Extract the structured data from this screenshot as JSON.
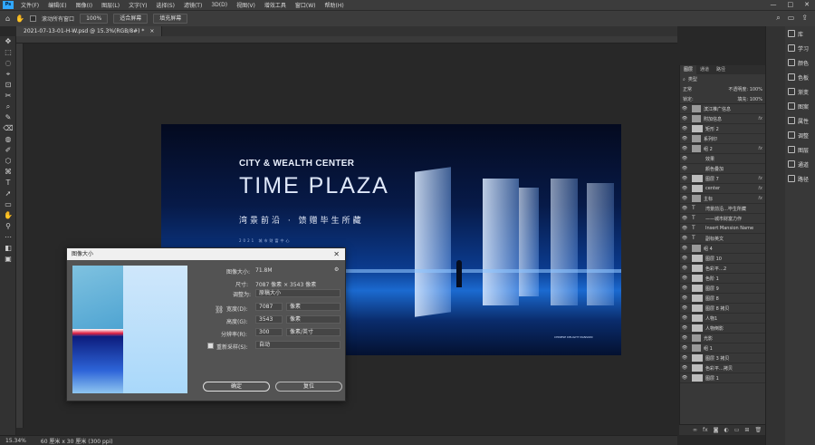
{
  "menubar": {
    "logo": "Ps",
    "items": [
      "文件(F)",
      "编辑(E)",
      "图像(I)",
      "图层(L)",
      "文字(Y)",
      "选择(S)",
      "滤镜(T)",
      "3D(D)",
      "视图(V)",
      "增效工具",
      "窗口(W)",
      "帮助(H)"
    ],
    "win_controls": [
      "—",
      "□",
      "✕"
    ]
  },
  "options": {
    "scroll_all": "滚动所有窗口",
    "zoom": "100%",
    "fit": "适合屏幕",
    "fill": "填充屏幕"
  },
  "tab": {
    "title": "2021-07-13-01-H-W.psd @ 15.3%(RGB/8#) *",
    "close": "×"
  },
  "poster": {
    "line1": "CITY & WEALTH CENTER",
    "line2": "TIME PLAZA",
    "line3": "湾景前沿 · 馈赠毕生所藏",
    "line4": "2021 城市财富中心",
    "brand": "CHINESE DELIGHT MANSION"
  },
  "status": {
    "zoom": "15.34%",
    "size": "60 厘米 x 30 厘米 (300 ppi)"
  },
  "libs": [
    {
      "label": "库"
    },
    {
      "label": "学习"
    },
    {
      "label": "颜色"
    },
    {
      "label": "色板"
    },
    {
      "label": "渐变"
    },
    {
      "label": "图案"
    },
    {
      "label": "属性"
    },
    {
      "label": "调整"
    },
    {
      "label": "图层"
    },
    {
      "label": "通道"
    },
    {
      "label": "路径"
    }
  ],
  "layers": {
    "tabs": [
      "图层",
      "通道",
      "路径"
    ],
    "search": "类型",
    "blend": "正常",
    "opacity": "不透明度: 100%",
    "lock": "锁定:",
    "fill": "填充: 100%",
    "rows": [
      {
        "name": "滨江推广信息",
        "kind": "folder",
        "fx": ""
      },
      {
        "name": "附加信息",
        "kind": "folder",
        "fx": "fx"
      },
      {
        "name": "矩形 2",
        "kind": "shape",
        "fx": ""
      },
      {
        "name": "系列印",
        "kind": "folder",
        "fx": ""
      },
      {
        "name": "组 2",
        "kind": "folder",
        "fx": "fx"
      },
      {
        "name": "效果",
        "kind": "sub",
        "fx": ""
      },
      {
        "name": "颜色叠加",
        "kind": "sub",
        "fx": ""
      },
      {
        "name": "图层 7",
        "kind": "pixel",
        "fx": "fx"
      },
      {
        "name": "center",
        "kind": "pixel",
        "fx": "fx"
      },
      {
        "name": "主标",
        "kind": "folder",
        "fx": "fx"
      },
      {
        "name": "湾景前沿…毕生所藏",
        "kind": "text",
        "fx": ""
      },
      {
        "name": "——城市财富力作",
        "kind": "text",
        "fx": ""
      },
      {
        "name": "Insert Mansion Name",
        "kind": "text",
        "fx": ""
      },
      {
        "name": "副标英文",
        "kind": "text",
        "fx": ""
      },
      {
        "name": "组 4",
        "kind": "folder",
        "fx": ""
      },
      {
        "name": "图层 10",
        "kind": "pixel",
        "fx": ""
      },
      {
        "name": "色彩平…2",
        "kind": "adj",
        "fx": ""
      },
      {
        "name": "色阶 1",
        "kind": "adj",
        "fx": ""
      },
      {
        "name": "图层 9",
        "kind": "pixel",
        "fx": ""
      },
      {
        "name": "图层 8",
        "kind": "pixel",
        "fx": ""
      },
      {
        "name": "图层 8 拷贝",
        "kind": "pixel",
        "fx": ""
      },
      {
        "name": "人物1",
        "kind": "pixel",
        "fx": ""
      },
      {
        "name": "人物倒影",
        "kind": "pixel",
        "fx": ""
      },
      {
        "name": "光影",
        "kind": "folder",
        "fx": ""
      },
      {
        "name": "组 1",
        "kind": "folder",
        "fx": ""
      },
      {
        "name": "图层 3 拷贝",
        "kind": "pixel",
        "fx": ""
      },
      {
        "name": "色彩平…拷贝",
        "kind": "adj",
        "fx": ""
      },
      {
        "name": "图层 1",
        "kind": "pixel",
        "fx": ""
      }
    ]
  },
  "dialog": {
    "title": "图像大小",
    "close": "✕",
    "image_size_label": "图像大小:",
    "image_size": "71.8M",
    "dim_label": "尺寸:",
    "dimensions": "7087 像素 × 3543 像素",
    "fit_label": "调整为:",
    "fit_value": "原稿大小",
    "width_label": "宽度(D):",
    "width_value": "7087",
    "width_unit": "像素",
    "height_label": "高度(G):",
    "height_value": "3543",
    "height_unit": "像素",
    "res_label": "分辨率(R):",
    "res_value": "300",
    "res_unit": "像素/英寸",
    "resample_label": "重新采样(S):",
    "resample_value": "自动",
    "ok": "确定",
    "reset": "复位"
  },
  "tools": [
    "✥",
    "⬚",
    "◌",
    "⌖",
    "⊡",
    "✂",
    "⌕",
    "✎",
    "⌫",
    "◍",
    "✐",
    "⬡",
    "⌘",
    "T",
    "➚",
    "▭",
    "✋",
    "⚲",
    "⋯",
    "◧",
    "▣"
  ]
}
